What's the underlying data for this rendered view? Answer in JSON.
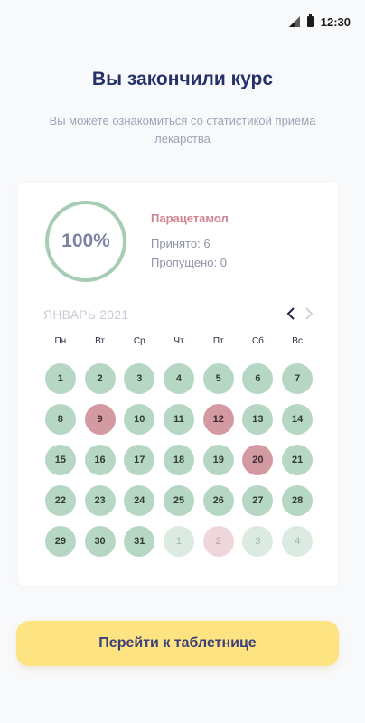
{
  "status_bar": {
    "time": "12:30"
  },
  "header": {
    "title": "Вы закончили курс",
    "subtitle": "Вы можете ознакомиться со статистикой приема лекарства"
  },
  "stats": {
    "percent_label": "100%",
    "drug_name": "Парацетамол",
    "taken": "Принято: 6",
    "missed": "Пропущено: 0"
  },
  "calendar": {
    "month": "ЯНВАРЬ 2021",
    "prev_icon": "chevron-left-icon",
    "next_icon": "chevron-right-icon",
    "weekdays": [
      "Пн",
      "Вт",
      "Ср",
      "Чт",
      "Пт",
      "Сб",
      "Вс"
    ],
    "days": [
      {
        "label": "1",
        "state": "taken"
      },
      {
        "label": "2",
        "state": "taken"
      },
      {
        "label": "3",
        "state": "taken"
      },
      {
        "label": "4",
        "state": "taken"
      },
      {
        "label": "5",
        "state": "taken"
      },
      {
        "label": "6",
        "state": "taken"
      },
      {
        "label": "7",
        "state": "taken"
      },
      {
        "label": "8",
        "state": "taken"
      },
      {
        "label": "9",
        "state": "missed"
      },
      {
        "label": "10",
        "state": "taken"
      },
      {
        "label": "11",
        "state": "taken"
      },
      {
        "label": "12",
        "state": "missed"
      },
      {
        "label": "13",
        "state": "taken"
      },
      {
        "label": "14",
        "state": "taken"
      },
      {
        "label": "15",
        "state": "taken"
      },
      {
        "label": "16",
        "state": "taken"
      },
      {
        "label": "17",
        "state": "taken"
      },
      {
        "label": "18",
        "state": "taken"
      },
      {
        "label": "19",
        "state": "taken"
      },
      {
        "label": "20",
        "state": "missed"
      },
      {
        "label": "21",
        "state": "taken"
      },
      {
        "label": "22",
        "state": "taken"
      },
      {
        "label": "23",
        "state": "taken"
      },
      {
        "label": "24",
        "state": "taken"
      },
      {
        "label": "25",
        "state": "taken"
      },
      {
        "label": "26",
        "state": "taken"
      },
      {
        "label": "27",
        "state": "taken"
      },
      {
        "label": "28",
        "state": "taken"
      },
      {
        "label": "29",
        "state": "taken"
      },
      {
        "label": "30",
        "state": "taken"
      },
      {
        "label": "31",
        "state": "taken"
      },
      {
        "label": "1",
        "state": "other"
      },
      {
        "label": "2",
        "state": "other-missed"
      },
      {
        "label": "3",
        "state": "other"
      },
      {
        "label": "4",
        "state": "other"
      }
    ]
  },
  "cta": {
    "label": "Перейти к таблетнице"
  },
  "colors": {
    "taken": "#b6d7c4",
    "missed": "#d49aa2",
    "accent_button": "#fde382",
    "title": "#26306a"
  }
}
